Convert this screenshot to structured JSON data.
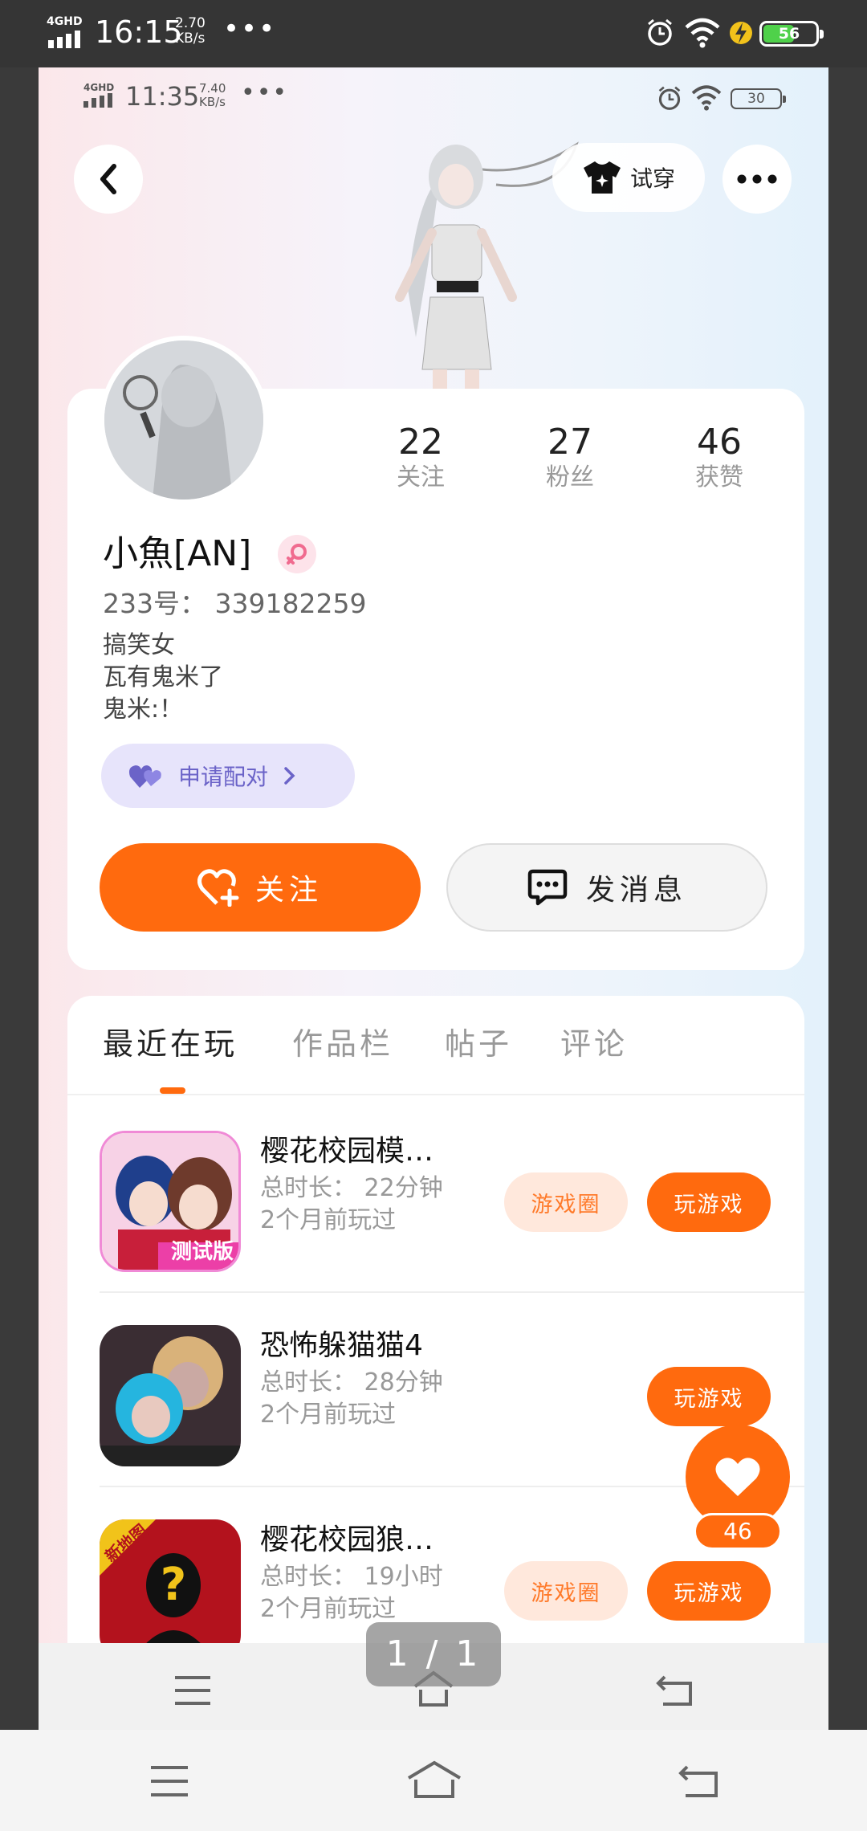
{
  "outer_status": {
    "network": "4GHD",
    "time": "16:15",
    "speed_value": "2.70",
    "speed_unit": "KB/s",
    "battery": "56",
    "icons": [
      "signal-icon",
      "alarm-icon",
      "wifi-icon",
      "charging-bolt-icon",
      "battery-icon"
    ]
  },
  "inner_status": {
    "network": "4GHD",
    "time": "11:35",
    "speed_value": "7.40",
    "speed_unit": "KB/s",
    "battery": "30"
  },
  "header": {
    "try_on_label": "试穿"
  },
  "profile": {
    "nickname": "小魚[AN]",
    "uid": "233号： 339182259",
    "bio": [
      "搞笑女",
      "瓦有鬼米了",
      "鬼米:！"
    ],
    "pair_label": "申请配对",
    "stats": [
      {
        "value": "22",
        "label": "关注"
      },
      {
        "value": "27",
        "label": "粉丝"
      },
      {
        "value": "46",
        "label": "获赞"
      }
    ],
    "follow_label": "关注",
    "message_label": "发消息"
  },
  "tabs": [
    "最近在玩",
    "作品栏",
    "帖子",
    "评论"
  ],
  "active_tab": "最近在玩",
  "games": [
    {
      "title": "樱花校园模…",
      "duration": "总时长： 22分钟",
      "last_played": "2个月前玩过",
      "circle_label": "游戏圈",
      "play_label": "玩游戏",
      "badge": "测试版"
    },
    {
      "title": "恐怖躲猫猫4",
      "duration": "总时长： 28分钟",
      "last_played": "2个月前玩过",
      "play_label": "玩游戏"
    },
    {
      "title": "樱花校园狼…",
      "duration": "总时长： 19小时",
      "last_played": "2个月前玩过",
      "circle_label": "游戏圈",
      "play_label": "玩游戏",
      "badge": "新地图"
    }
  ],
  "like_fab_count": "46",
  "page_indicator": "1 / 1",
  "colors": {
    "accent": "#ff6a0e",
    "pair_bg": "#e7e4fb",
    "pair_text": "#6b63c8",
    "battery_green": "#4fd14a"
  }
}
